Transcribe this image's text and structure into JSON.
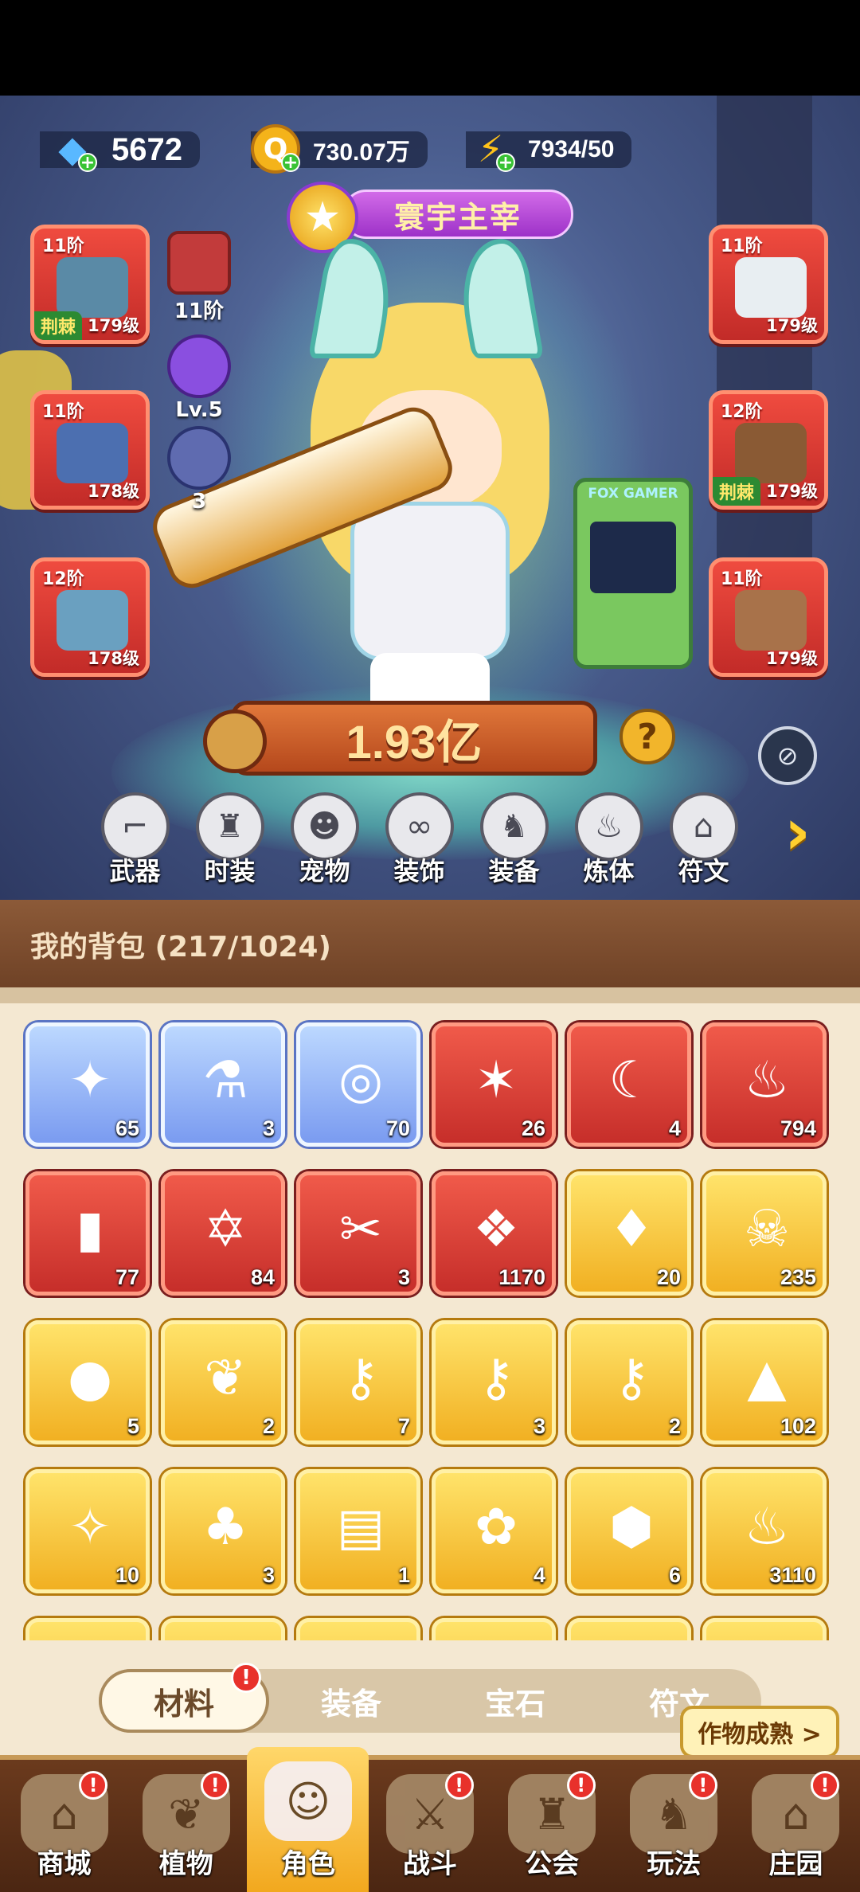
{
  "currency": {
    "gems": "5672",
    "gold": "730.07万",
    "energy": "7934/50"
  },
  "title_badge": "寰宇主宰",
  "equipment": {
    "left": [
      {
        "tier": "11阶",
        "level": "179级",
        "tag": "荆棘"
      },
      {
        "tier": "11阶",
        "level": "178级",
        "tag": ""
      },
      {
        "tier": "12阶",
        "level": "178级",
        "tag": ""
      }
    ],
    "right": [
      {
        "tier": "11阶",
        "level": "179级",
        "tag": ""
      },
      {
        "tier": "12阶",
        "level": "179级",
        "tag": "荆棘"
      },
      {
        "tier": "11阶",
        "level": "179级",
        "tag": ""
      }
    ],
    "side": [
      {
        "label": "11阶"
      },
      {
        "label": "Lv.5"
      },
      {
        "label": "3"
      }
    ]
  },
  "arcade_sign": "FOX GAMER",
  "power": "1.93亿",
  "categories": [
    "武器",
    "时装",
    "宠物",
    "装饰",
    "装备",
    "炼体",
    "符文"
  ],
  "bag": {
    "title": "我的背包 (217/1024)",
    "items": [
      {
        "count": "65",
        "rarity": "blue",
        "icon": "scarab-amulet-icon",
        "glyph": "✦"
      },
      {
        "count": "3",
        "rarity": "blue",
        "icon": "syringe-icon",
        "glyph": "⚗"
      },
      {
        "count": "70",
        "rarity": "blue",
        "icon": "planet-ring-icon",
        "glyph": "◎"
      },
      {
        "count": "26",
        "rarity": "red",
        "icon": "blue-star-crystal-icon",
        "glyph": "✶"
      },
      {
        "count": "4",
        "rarity": "red",
        "icon": "moon-star-icon",
        "glyph": "☾"
      },
      {
        "count": "794",
        "rarity": "red",
        "icon": "red-potion-icon",
        "glyph": "♨"
      },
      {
        "count": "77",
        "rarity": "red",
        "icon": "green-tube-icon",
        "glyph": "▮"
      },
      {
        "count": "84",
        "rarity": "red",
        "icon": "hexagram-crystal-icon",
        "glyph": "✡"
      },
      {
        "count": "3",
        "rarity": "red",
        "icon": "scissors-icon",
        "glyph": "✂"
      },
      {
        "count": "1170",
        "rarity": "red",
        "icon": "purple-crystal-cluster-icon",
        "glyph": "❖"
      },
      {
        "count": "20",
        "rarity": "gold",
        "icon": "perfume-bottle-icon",
        "glyph": "♦"
      },
      {
        "count": "235",
        "rarity": "gold",
        "icon": "skull-scroll-icon",
        "glyph": "☠"
      },
      {
        "count": "5",
        "rarity": "gold",
        "icon": "prayer-beads-icon",
        "glyph": "●"
      },
      {
        "count": "2",
        "rarity": "gold",
        "icon": "bamboo-shoot-icon",
        "glyph": "❦"
      },
      {
        "count": "7",
        "rarity": "gold",
        "icon": "ruby-key-icon",
        "glyph": "⚷"
      },
      {
        "count": "3",
        "rarity": "gold",
        "icon": "gold-key-icon",
        "glyph": "⚷"
      },
      {
        "count": "2",
        "rarity": "gold",
        "icon": "emerald-key-icon",
        "glyph": "⚷"
      },
      {
        "count": "102",
        "rarity": "gold",
        "icon": "pyramid-prism-icon",
        "glyph": "▲"
      },
      {
        "count": "10",
        "rarity": "gold",
        "icon": "purple-star-orb-icon",
        "glyph": "✧"
      },
      {
        "count": "3",
        "rarity": "gold",
        "icon": "blue-mushroom-icon",
        "glyph": "♣"
      },
      {
        "count": "1",
        "rarity": "gold",
        "icon": "red-book-icon",
        "glyph": "▤"
      },
      {
        "count": "4",
        "rarity": "gold",
        "icon": "golden-rose-icon",
        "glyph": "✿"
      },
      {
        "count": "6",
        "rarity": "gold",
        "icon": "dark-rune-stone-icon",
        "glyph": "⬢"
      },
      {
        "count": "3110",
        "rarity": "gold",
        "icon": "orange-potion-icon",
        "glyph": "♨"
      }
    ]
  },
  "tabs": [
    "材料",
    "装备",
    "宝石",
    "符文"
  ],
  "harvest_button": "作物成熟 >",
  "nav": [
    "商城",
    "植物",
    "角色",
    "战斗",
    "公会",
    "玩法",
    "庄园"
  ],
  "badge_mark": "!"
}
